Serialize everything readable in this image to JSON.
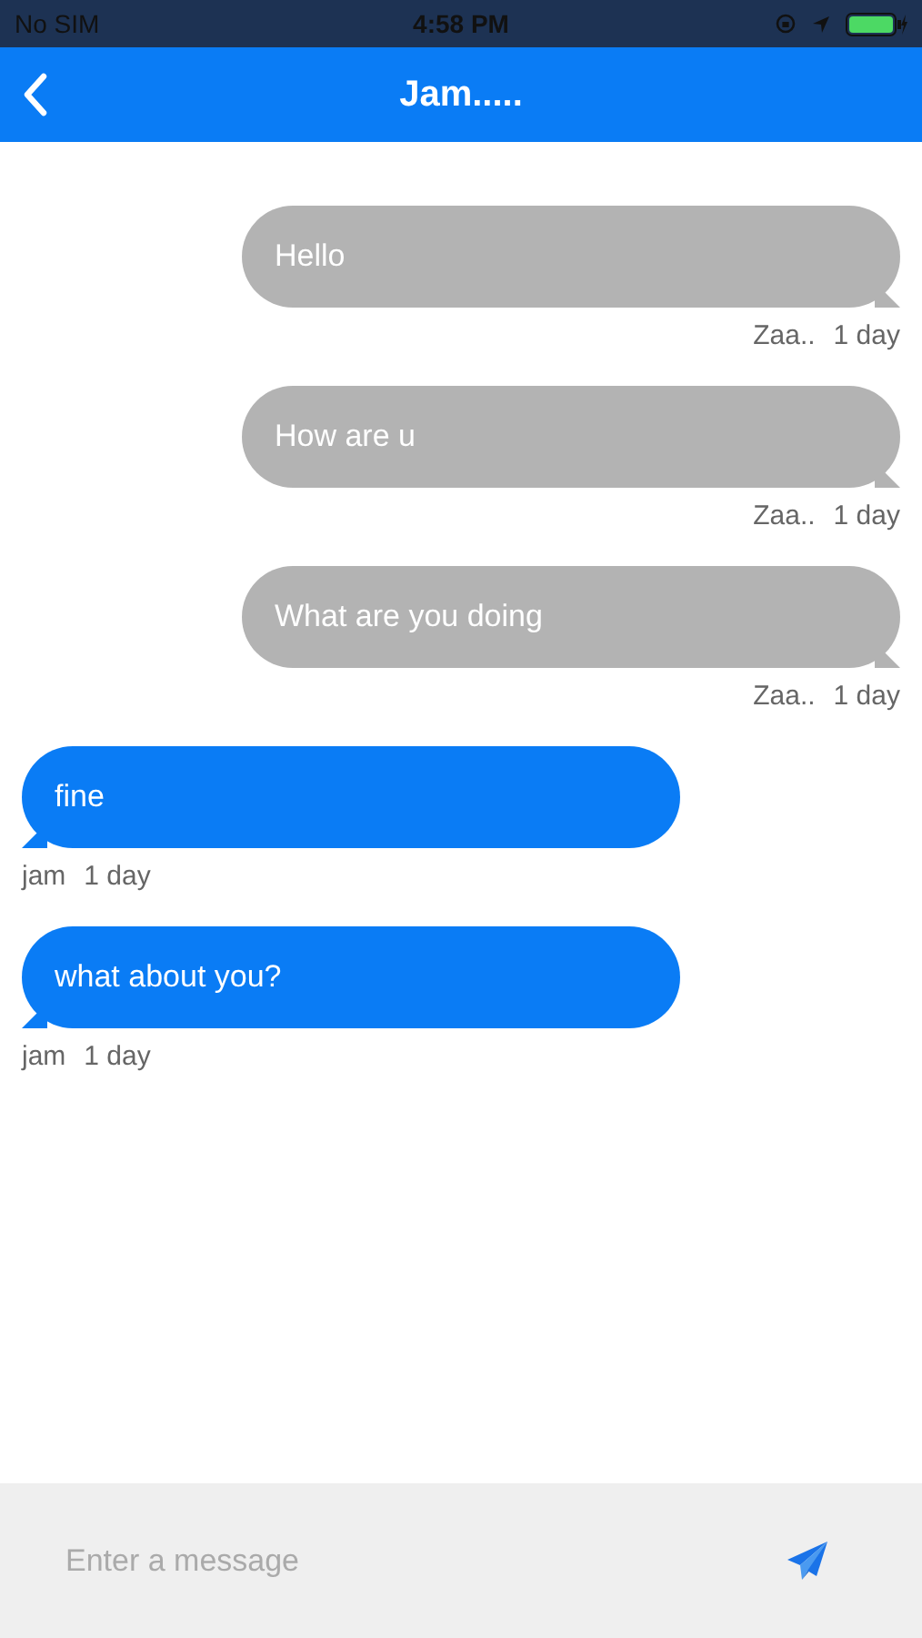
{
  "status_bar": {
    "carrier": "No SIM",
    "time": "4:58 PM"
  },
  "header": {
    "title": "Jam....."
  },
  "messages": [
    {
      "kind": "outgoing",
      "text": "Hello",
      "sender": "Zaa..",
      "time": "1 day"
    },
    {
      "kind": "outgoing",
      "text": "How are u",
      "sender": "Zaa..",
      "time": "1 day"
    },
    {
      "kind": "outgoing",
      "text": "What are you doing",
      "sender": "Zaa..",
      "time": "1 day"
    },
    {
      "kind": "incoming",
      "text": "fine",
      "sender": "jam",
      "time": "1 day"
    },
    {
      "kind": "incoming",
      "text": "what about you?",
      "sender": "jam",
      "time": "1 day"
    }
  ],
  "composer": {
    "placeholder": "Enter a message"
  }
}
